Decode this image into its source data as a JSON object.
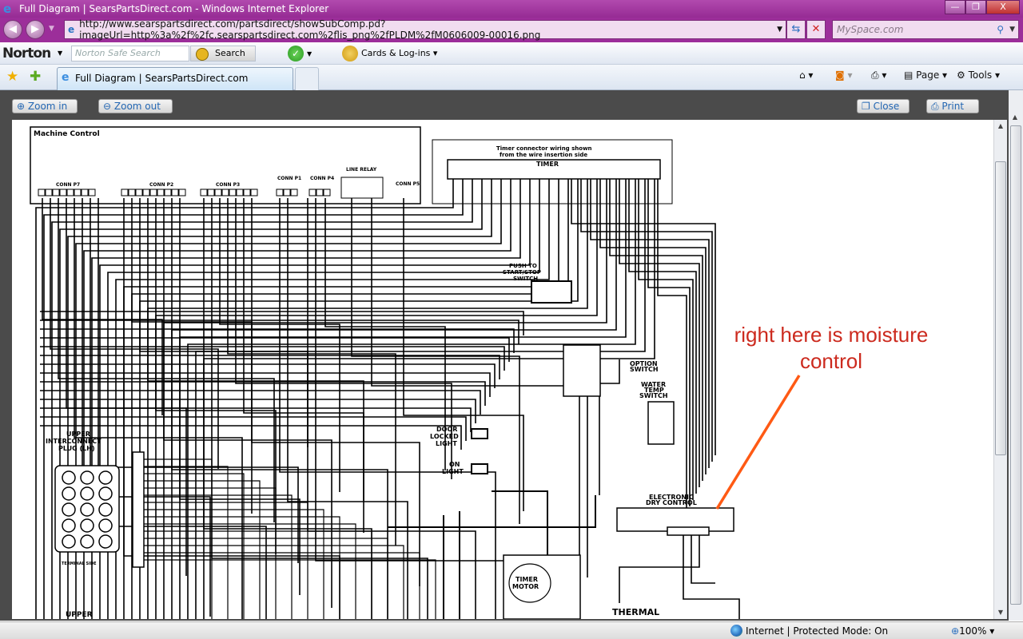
{
  "window": {
    "title": "Full Diagram | SearsPartsDirect.com - Windows Internet Explorer",
    "min": "—",
    "max": "❐",
    "close": "X"
  },
  "address": {
    "url": "http://www.searspartsdirect.com/partsdirect/showSubComp.pd?imageUrl=http%3a%2f%2fc.searspartsdirect.com%2flis_png%2fPLDM%2fM0606009-00016.png",
    "search_placeholder": "MySpace.com"
  },
  "norton": {
    "logo": "Norton",
    "search_placeholder": "Norton Safe Search",
    "search_button": "Search",
    "cards": "Cards & Log-ins"
  },
  "tabs": [
    {
      "label": "Full Diagram | SearsPartsDirect.com"
    }
  ],
  "commandbar": {
    "page": "Page",
    "tools": "Tools"
  },
  "viewer": {
    "zoom_in": "Zoom in",
    "zoom_out": "Zoom out",
    "close": "Close",
    "print": "Print"
  },
  "diagram": {
    "machine_control": "Machine Control",
    "conn_p7": "CONN P7",
    "conn_p2": "CONN P2",
    "conn_p3": "CONN P3",
    "conn_p1": "CONN P1",
    "conn_p4": "CONN P4",
    "conn_p5": "CONN P5",
    "line_relay": "LINE RELAY",
    "timer_note_1": "Timer connector wiring shown",
    "timer_note_2": "from the wire insertion side",
    "timer": "TIMER",
    "push_to_start_1": "PUSH TO",
    "push_to_start_2": "START/STOP",
    "push_to_start_3": "SWITCH",
    "option_switch_1": "OPTION",
    "option_switch_2": "SWITCH",
    "water_temp_1": "WATER",
    "water_temp_2": "TEMP",
    "water_temp_3": "SWITCH",
    "door_locked_1": "DOOR",
    "door_locked_2": "LOCKED",
    "door_locked_3": "LIGHT",
    "on_light_1": "ON",
    "on_light_2": "LIGHT",
    "edc_1": "ELECTRONIC",
    "edc_2": "DRY CONTROL",
    "timer_motor_1": "TIMER",
    "timer_motor_2": "MOTOR",
    "upper_plug_1": "UPPER",
    "upper_plug_2": "INTERCONNECT",
    "upper_plug_3": "PLUG (LH)",
    "terminal_side": "TERMINAL SIDE",
    "upper_bottom": "UPPER",
    "thermal": "THERMAL"
  },
  "annotation": {
    "line1": "right here is moisture",
    "line2": "control",
    "color": "#cc2a1e",
    "arrow_color": "#ff5a14"
  },
  "status": {
    "zone": "Internet | Protected Mode: On",
    "zoom": "100%"
  }
}
